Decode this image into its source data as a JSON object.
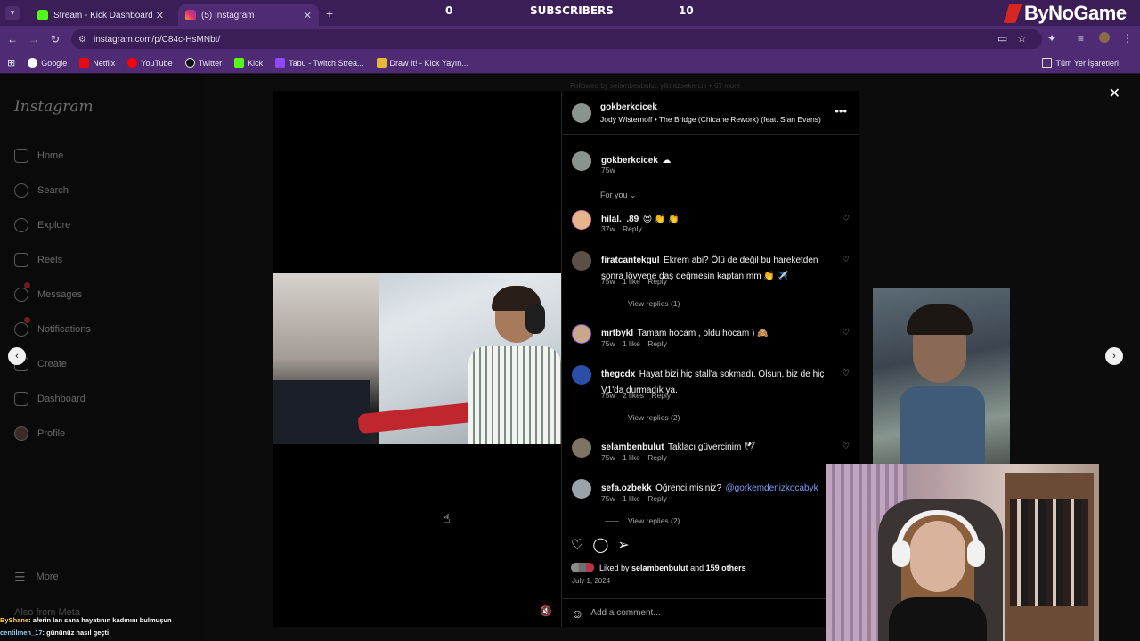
{
  "browser": {
    "tabs": [
      {
        "title": "Stream - Kick Dashboard",
        "active": false,
        "icon": "kick-icon"
      },
      {
        "title": "(5) Instagram",
        "active": true,
        "icon": "instagram-icon"
      }
    ],
    "url": "instagram.com/p/C84c-HsMNbt/",
    "bookmarks": [
      "Google",
      "Netflix",
      "YouTube",
      "Twitter",
      "Kick",
      "Tabu - Twitch Strea...",
      "Draw It! - Kick Yayın..."
    ],
    "bookmarks_right": "Tüm Yer İşaretleri"
  },
  "overlay": {
    "counter_left": "0",
    "counter_label": "SUBSCRIBERS",
    "counter_right": "10",
    "brand": "ByNoGame"
  },
  "sidebar": {
    "logo": "Instagram",
    "items": [
      {
        "label": "Home",
        "icon": "home-icon"
      },
      {
        "label": "Search",
        "icon": "search-icon"
      },
      {
        "label": "Explore",
        "icon": "compass-icon"
      },
      {
        "label": "Reels",
        "icon": "reels-icon"
      },
      {
        "label": "Messages",
        "icon": "messages-icon"
      },
      {
        "label": "Notifications",
        "icon": "heart-icon"
      },
      {
        "label": "Create",
        "icon": "plus-icon"
      },
      {
        "label": "Dashboard",
        "icon": "dashboard-icon"
      },
      {
        "label": "Profile",
        "icon": "avatar-icon"
      }
    ],
    "more": "More",
    "also_from_meta": "Also from Meta"
  },
  "background_feed": {
    "followed_by": "Followed by selambenbulut, yilmazsekercili + 67 more"
  },
  "post": {
    "author": "gokberkcicek",
    "audio": "Jody Wisternoff • The Bridge (Chicane Rework) (feat. Sian Evans)",
    "caption_user": "gokberkcicek",
    "caption_emoji": "☁",
    "caption_time": "75w",
    "sort_label": "For you",
    "likes_text": "Liked by",
    "likes_user": "selambenbulut",
    "likes_and": "and",
    "likes_others": "159 others",
    "date": "July 1, 2024",
    "add_comment_placeholder": "Add a comment..."
  },
  "comments": [
    {
      "user": "hilal._.89",
      "text": "😍 👏 👏",
      "time": "37w",
      "likes": "",
      "reply": "Reply",
      "view_replies": ""
    },
    {
      "user": "firatcantekgul",
      "text": "Ekrem abi? Ölü de değil bu hareketden sonra lövyene daş değmesin kaptanımm 👏 ✈️",
      "time": "75w",
      "likes": "1 like",
      "reply": "Reply",
      "view_replies": "View replies (1)"
    },
    {
      "user": "mrtbykl",
      "text": "Tamam hocam , oldu hocam ) 🙈",
      "time": "75w",
      "likes": "1 like",
      "reply": "Reply",
      "view_replies": ""
    },
    {
      "user": "thegcdx",
      "text": "Hayat bizi hiç stall'a sokmadı. Olsun, biz de hiç V1'da durmadık ya.",
      "time": "75w",
      "likes": "2 likes",
      "reply": "Reply",
      "view_replies": "View replies (2)"
    },
    {
      "user": "selambenbulut",
      "text": "Taklacı güvercinim 🕊",
      "time": "75w",
      "likes": "1 like",
      "reply": "Reply",
      "view_replies": ""
    },
    {
      "user": "sefa.ozbekk",
      "text": "Öğrenci misiniz?",
      "mention": "@gorkemdenizkocabyk",
      "time": "75w",
      "likes": "1 like",
      "reply": "Reply",
      "view_replies": "View replies (2)"
    }
  ],
  "chat": [
    {
      "user": "ByShane",
      "text": ": aferin lan sana hayatının kadınını bulmuşun"
    },
    {
      "user": "centilmen_17",
      "text": ": gününüz nasıl geçti"
    }
  ],
  "colors": {
    "chrome": "#4f2b73",
    "tab_bar": "#3b1e57",
    "accent_link": "#7f9cf5"
  }
}
